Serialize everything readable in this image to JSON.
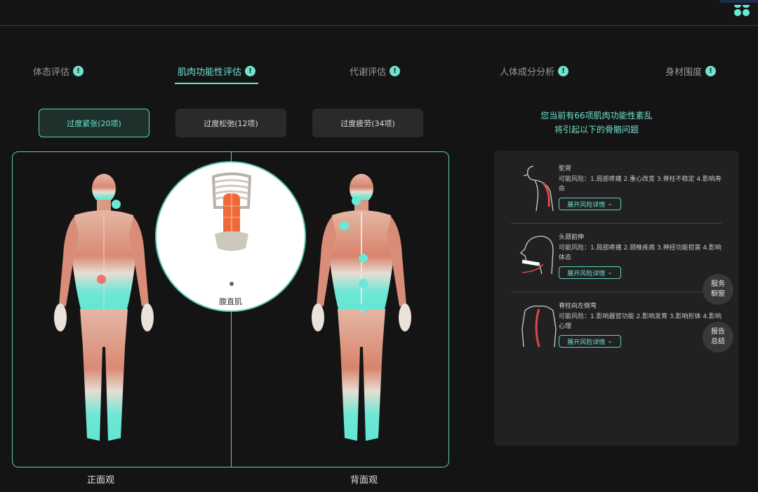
{
  "tabs": [
    {
      "label": "体态评估",
      "badge": "!"
    },
    {
      "label": "肌肉功能性评估",
      "badge": "!"
    },
    {
      "label": "代谢评估",
      "badge": "!"
    },
    {
      "label": "人体成分分析",
      "badge": "!"
    },
    {
      "label": "身材围度",
      "badge": "!"
    }
  ],
  "filters": [
    {
      "label": "过度紧张(20项)",
      "active": true
    },
    {
      "label": "过度松弛(12项)",
      "active": false
    },
    {
      "label": "过度疲劳(34项)",
      "active": false
    }
  ],
  "summary": {
    "line1": "您当前有66项肌肉功能性紊乱",
    "line2": "将引起以下的骨骼问题"
  },
  "zoom": {
    "muscle_name": "腹直肌"
  },
  "views": {
    "front": "正面观",
    "back": "背面观"
  },
  "risks": [
    {
      "title": "驼背",
      "desc": "可能风险：1.局部疼痛 2.重心改变 3.脊柱不稳定 4.影响寿命",
      "expand_label": "展开风险详情"
    },
    {
      "title": "头颈前伸",
      "desc": "可能风险：1.局部疼痛 2.颈椎疾病 3.神经功能损害 4.影响体态",
      "expand_label": "展开风险详情"
    },
    {
      "title": "脊柱向左侧弯",
      "desc": "可能风险：1.影响器官功能 2.影响发育 3.影响形体 4.影响心理",
      "expand_label": "展开风险详情"
    }
  ],
  "float_buttons": {
    "service_line1": "服务",
    "service_line2": "橱窗",
    "report_line1": "报告",
    "report_line2": "总结"
  },
  "colors": {
    "accent": "#6fe3cf",
    "hotspot": "#f0736b",
    "panel": "#212121",
    "background": "#141414"
  },
  "icons": {
    "chevron": "chevron-down-icon",
    "info": "info-icon"
  }
}
